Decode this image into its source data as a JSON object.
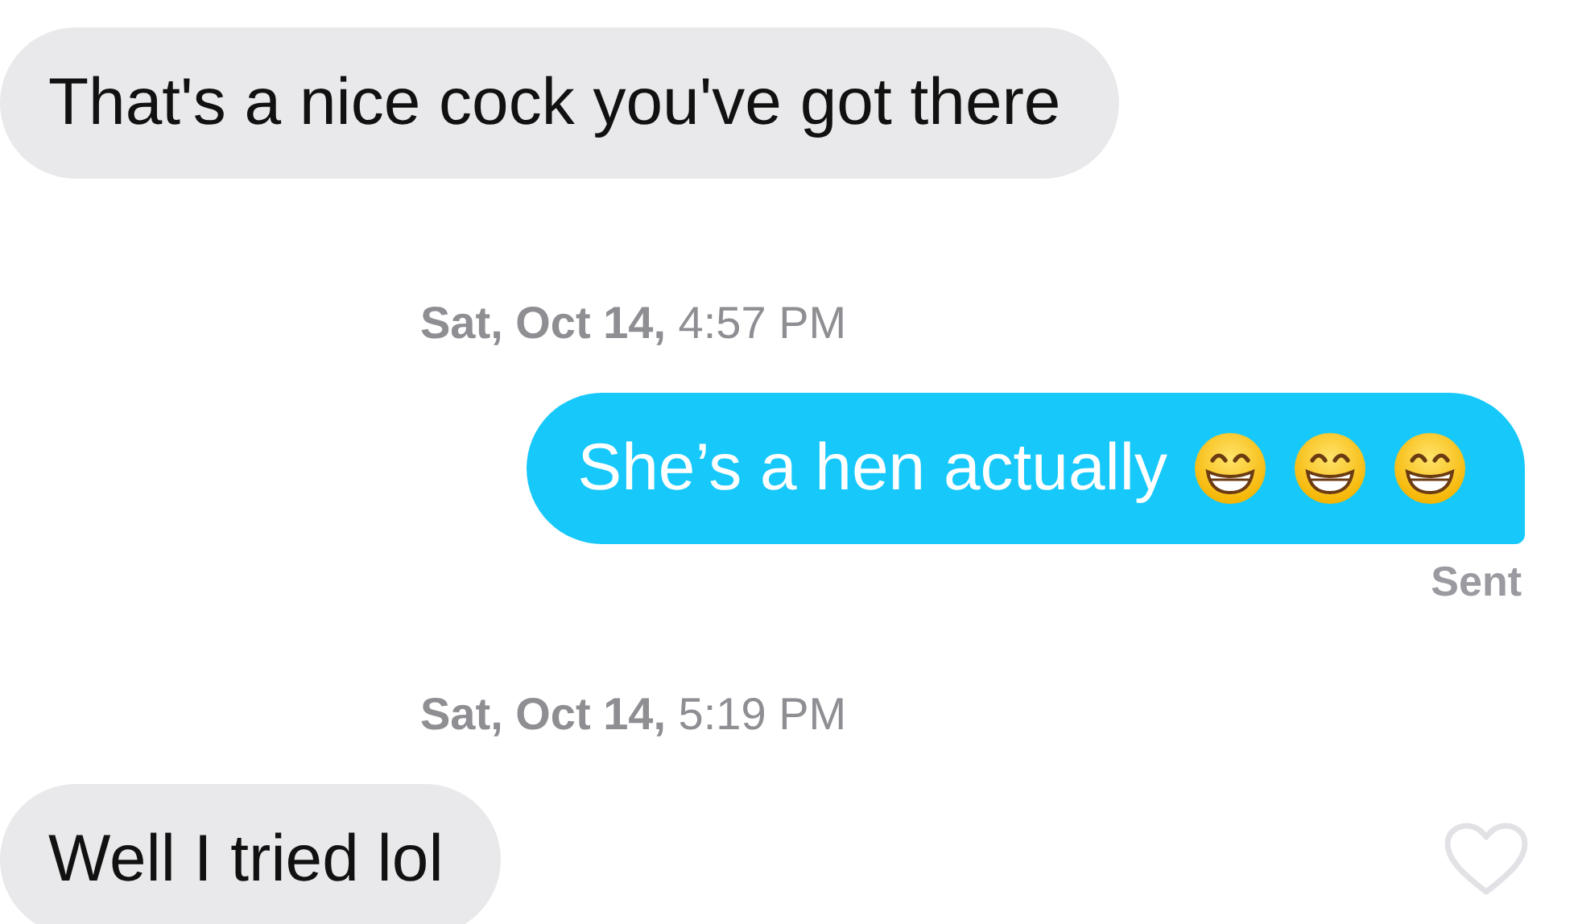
{
  "messages": [
    {
      "kind": "received",
      "text": "That's a nice cock you've got there"
    },
    {
      "kind": "timestamp",
      "date": "Sat, Oct 14,",
      "time": "4:57 PM"
    },
    {
      "kind": "sent",
      "text": "She’s a hen actually",
      "status": "Sent"
    },
    {
      "kind": "timestamp",
      "date": "Sat, Oct 14,",
      "time": "5:19 PM"
    },
    {
      "kind": "received",
      "text": "Well I tried lol",
      "liked": false
    }
  ]
}
